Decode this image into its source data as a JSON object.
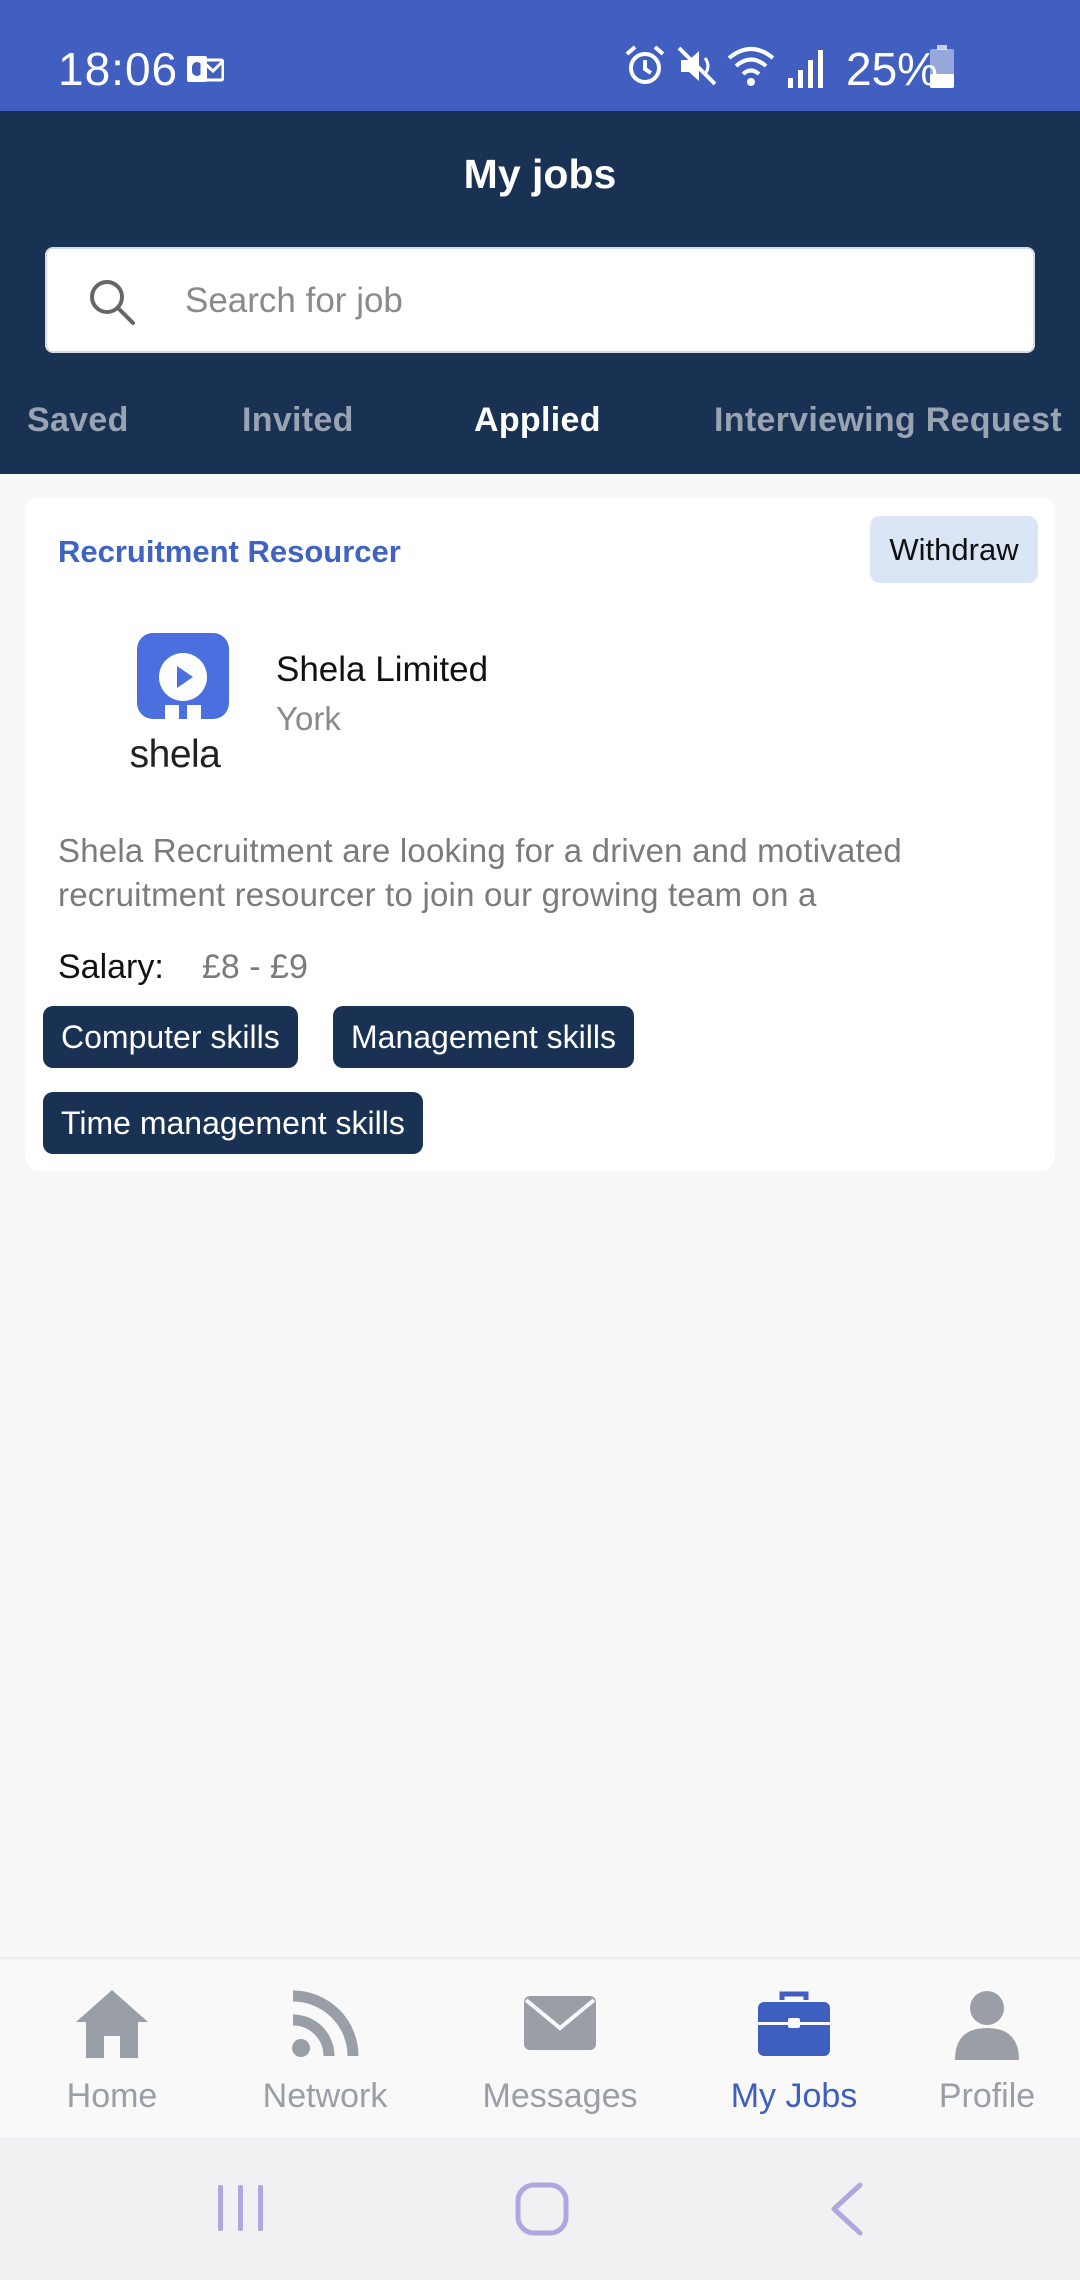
{
  "status_bar": {
    "time": "18:06",
    "battery": "25%"
  },
  "header": {
    "title": "My jobs",
    "search": {
      "placeholder": "Search for job",
      "value": ""
    },
    "tabs": [
      "Saved",
      "Invited",
      "Applied",
      "Interviewing Request"
    ],
    "active_tab": "Applied"
  },
  "job": {
    "title": "Recruitment Resourcer",
    "withdraw_label": "Withdraw",
    "logo_text": "shela",
    "company": "Shela Limited",
    "location": "York",
    "description": "Shela Recruitment are looking for a driven and motivated recruitment resourcer to join our growing team on a",
    "salary_label": "Salary:",
    "salary_value": "£8 - £9",
    "skills": [
      "Computer skills",
      "Management skills",
      "Time management skills"
    ]
  },
  "bottom_nav": {
    "items": [
      {
        "label": "Home",
        "icon": "home-icon"
      },
      {
        "label": "Network",
        "icon": "rss-icon"
      },
      {
        "label": "Messages",
        "icon": "envelope-icon"
      },
      {
        "label": "My Jobs",
        "icon": "briefcase-icon"
      },
      {
        "label": "Profile",
        "icon": "person-icon"
      }
    ],
    "active": "My Jobs"
  },
  "colors": {
    "status_bar": "#415fc0",
    "header": "#193254",
    "accent": "#3f63c2",
    "chip": "#193254",
    "withdraw_bg": "#dae6f5"
  }
}
